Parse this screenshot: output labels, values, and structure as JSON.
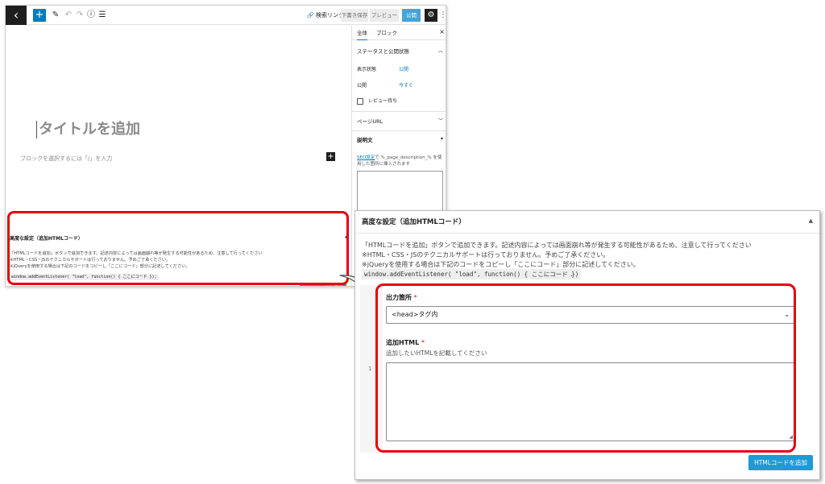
{
  "editor": {
    "toolbar": {
      "back_icon": "wordpress-back-icon",
      "add_icon": "+",
      "preview_link": "🔗 検索リンク",
      "draft_save": "下書き保存",
      "preview": "プレビュー",
      "publish": "公開",
      "settings_icon": "⚙",
      "more_icon": "⋮"
    },
    "title_placeholder": "タイトルを追加",
    "block_hint": "ブロックを選択するには「/」を入力",
    "sidebar": {
      "tab_post": "全体",
      "tab_block": "ブロック",
      "close": "×",
      "status_title": "ステータスと公開状態",
      "visibility_label": "表示状態",
      "visibility_value": "公開",
      "publish_label": "公開",
      "publish_value": "今すぐ",
      "review_label": "レビュー待ち",
      "page_url": "ページURL",
      "description_title": "説明文",
      "desc_help_link": "SEO設定",
      "desc_help_text": "で %_page_description_% を使用した箇所に挿入されます"
    }
  },
  "advanced": {
    "title": "高度な設定（追加HTMLコード）",
    "caret": "▲",
    "line1": "「HTMLコードを追加」ボタンで追加できます。記述内容によっては画面崩れ等が発生する可能性があるため、注意して行ってください",
    "line2": "※HTML・CSS・JSのテクニカルサポートは行っておりません。予めご了承ください。",
    "line3": "※jQueryを使用する場合は下記のコードをコピーし「ここにコード」部分に記述してください。",
    "code": "window.addEventListener( \"load\", function() { ここにコード });",
    "zoom_code": "window.addEventListener( \"load\", function() { ここにコード })",
    "add_button": "HTMLコードを追加",
    "row_number": "1",
    "output_label": "出力箇所",
    "required": "*",
    "output_value": "<head>タグ内",
    "html_label": "追加HTML",
    "html_help": "追加したいHTMLを記載してください",
    "period": "."
  },
  "colors": {
    "highlight": "#e60012",
    "accent": "#1e9ad6"
  }
}
